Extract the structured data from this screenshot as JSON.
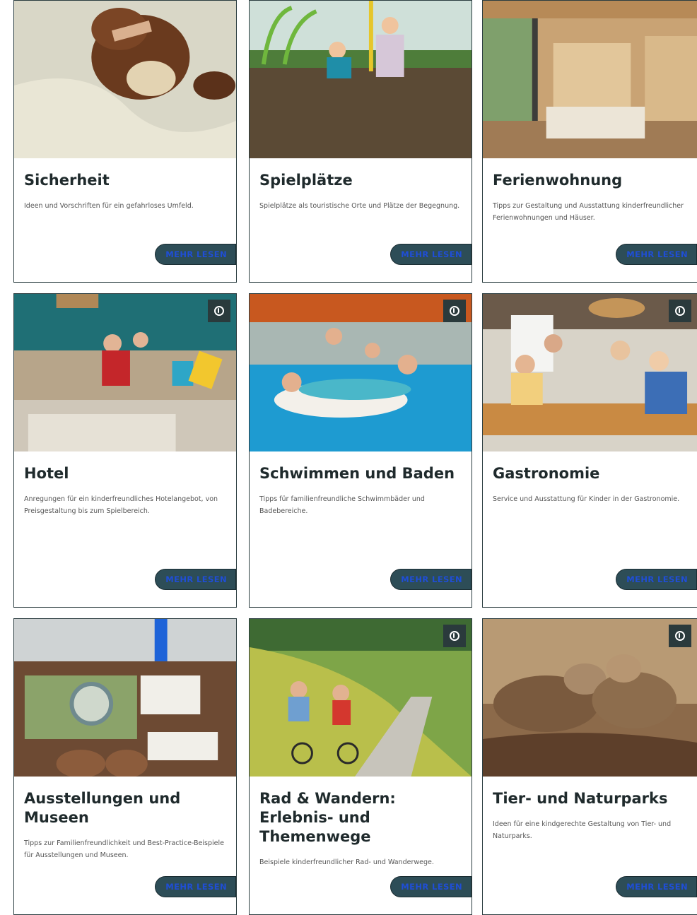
{
  "cards": [
    {
      "title": "Sicherheit",
      "desc": "Ideen und Vorschriften für ein gefahrloses Umfeld.",
      "more": "MEHR LESEN"
    },
    {
      "title": "Spielplätze",
      "desc": "Spielplätze als touristische Orte und Plätze der Begegnung.",
      "more": "MEHR LESEN"
    },
    {
      "title": "Ferienwohnung",
      "desc": "Tipps zur Gestaltung und Ausstattung kinderfreundlicher Ferienwohnungen und Häuser.",
      "more": "MEHR LESEN"
    },
    {
      "title": "Hotel",
      "desc": "Anregungen für ein kinderfreundliches Hotelangebot, von Preisgestaltung bis zum Spielbereich.",
      "more": "MEHR LESEN"
    },
    {
      "title": "Schwimmen und Baden",
      "desc": "Tipps für familienfreundliche Schwimmbäder und Badebereiche.",
      "more": "MEHR LESEN"
    },
    {
      "title": "Gastronomie",
      "desc": "Service und Ausstattung für Kinder in der Gastronomie.",
      "more": "MEHR LESEN"
    },
    {
      "title": "Ausstellungen und Museen",
      "desc": "Tipps zur Familienfreundlichkeit und Best-Practice-Beispiele für Ausstellungen und Museen.",
      "more": "MEHR LESEN"
    },
    {
      "title": "Rad & Wandern: Erlebnis- und Themenwege",
      "desc": "Beispiele kinderfreundlicher Rad- und Wanderwege.",
      "more": "MEHR LESEN"
    },
    {
      "title": "Tier- und Naturparks",
      "desc": "Ideen für eine kindgerechte Gestaltung von Tier- und Naturparks.",
      "more": "MEHR LESEN"
    }
  ],
  "icons": {
    "info": "info-icon"
  }
}
